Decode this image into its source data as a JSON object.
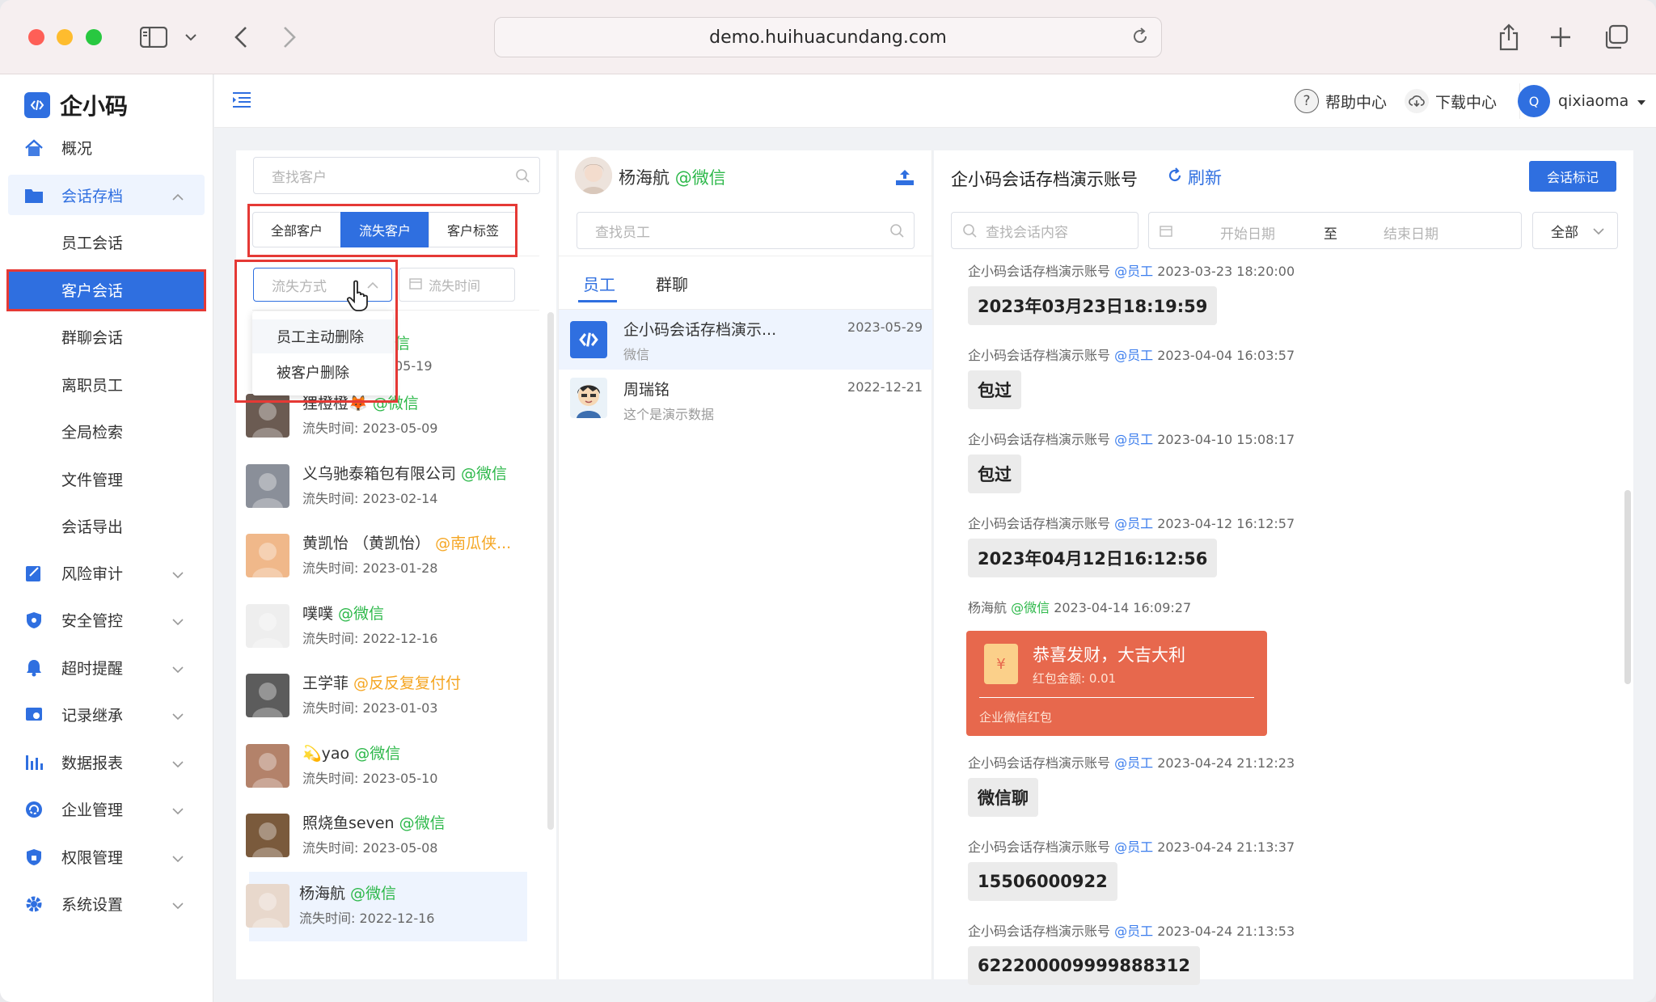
{
  "browser": {
    "url": "demo.huihuacundang.com"
  },
  "app": {
    "logo_text": "企小码"
  },
  "sidebar": {
    "items": [
      {
        "label": "概况",
        "icon": "home-icon"
      },
      {
        "label": "会话存档",
        "icon": "folder-icon"
      },
      {
        "label": "风险审计",
        "icon": "audit-icon"
      },
      {
        "label": "安全管控",
        "icon": "shield-icon"
      },
      {
        "label": "超时提醒",
        "icon": "bell-icon"
      },
      {
        "label": "记录继承",
        "icon": "inherit-icon"
      },
      {
        "label": "数据报表",
        "icon": "chart-icon"
      },
      {
        "label": "企业管理",
        "icon": "enterprise-icon"
      },
      {
        "label": "权限管理",
        "icon": "lock-shield-icon"
      },
      {
        "label": "系统设置",
        "icon": "gear-icon"
      }
    ],
    "sub_items": [
      {
        "label": "员工会话"
      },
      {
        "label": "客户会话"
      },
      {
        "label": "群聊会话"
      },
      {
        "label": "离职员工"
      },
      {
        "label": "全局检索"
      },
      {
        "label": "文件管理"
      },
      {
        "label": "会话导出"
      }
    ]
  },
  "header": {
    "help": "帮助中心",
    "download": "下载中心",
    "avatar_letter": "Q",
    "username": "qixiaoma"
  },
  "customers": {
    "search_placeholder": "查找客户",
    "tabs": [
      "全部客户",
      "流失客户",
      "客户标签"
    ],
    "filter_placeholder": "流失方式",
    "time_placeholder": "流失时间",
    "dropdown": [
      "员工主动删除",
      "被客户删除"
    ],
    "partial_item": {
      "tag_tail": "信",
      "time_tail": "05-19"
    },
    "list": [
      {
        "name": "狸橙橙🦊",
        "tag": "@微信",
        "tag_color": "green",
        "time": "流失时间: 2023-05-09"
      },
      {
        "name": "义乌驰泰箱包有限公司",
        "tag": "@微信",
        "tag_color": "green",
        "time": "流失时间: 2023-02-14"
      },
      {
        "name": "黄凯怡 （黄凯怡）",
        "tag": "@南瓜侠...",
        "tag_color": "orange",
        "time": "流失时间: 2023-01-28"
      },
      {
        "name": "噗噗",
        "tag": "@微信",
        "tag_color": "green",
        "time": "流失时间: 2022-12-16"
      },
      {
        "name": "王学菲",
        "tag": "@反反复复付付",
        "tag_color": "orange",
        "time": "流失时间: 2023-01-03"
      },
      {
        "name": "💫yao",
        "tag": "@微信",
        "tag_color": "green",
        "time": "流失时间: 2023-05-10"
      },
      {
        "name": "照烧鱼seven",
        "tag": "@微信",
        "tag_color": "green",
        "time": "流失时间: 2023-05-08"
      },
      {
        "name": "杨海航",
        "tag": "@微信",
        "tag_color": "green",
        "time": "流失时间: 2022-12-16"
      }
    ]
  },
  "employees": {
    "customer_name": "杨海航",
    "customer_tag": "@微信",
    "search_placeholder": "查找员工",
    "tabs": [
      "员工",
      "群聊"
    ],
    "list": [
      {
        "name": "企小码会话存档演示...",
        "sub": "微信",
        "date": "2023-05-29"
      },
      {
        "name": "周瑞铭",
        "sub": "这个是演示数据",
        "date": "2022-12-21"
      }
    ]
  },
  "chat": {
    "title": "企小码会话存档演示账号",
    "refresh": "刷新",
    "mark_button": "会话标记",
    "search_placeholder": "查找会话内容",
    "start_date": "开始日期",
    "to": "至",
    "end_date": "结束日期",
    "filter": "全部",
    "messages": [
      {
        "sender": "企小码会话存档演示账号",
        "tag": "@员工",
        "time": "2023-03-23 18:20:00",
        "text": "2023年03月23日18:19:59"
      },
      {
        "sender": "企小码会话存档演示账号",
        "tag": "@员工",
        "time": "2023-04-04 16:03:57",
        "text": "包过"
      },
      {
        "sender": "企小码会话存档演示账号",
        "tag": "@员工",
        "time": "2023-04-10 15:08:17",
        "text": "包过"
      },
      {
        "sender": "企小码会话存档演示账号",
        "tag": "@员工",
        "time": "2023-04-12 16:12:57",
        "text": "2023年04月12日16:12:56"
      },
      {
        "sender": "杨海航",
        "tag": "@微信",
        "time": "2023-04-14 16:09:27"
      },
      {
        "sender": "企小码会话存档演示账号",
        "tag": "@员工",
        "time": "2023-04-24 21:12:23",
        "text": "微信聊"
      },
      {
        "sender": "企小码会话存档演示账号",
        "tag": "@员工",
        "time": "2023-04-24 21:13:37",
        "text": "15506000922"
      },
      {
        "sender": "企小码会话存档演示账号",
        "tag": "@员工",
        "time": "2023-04-24 21:13:53",
        "text": "622200009999888312"
      }
    ],
    "red_packet": {
      "title": "恭喜发财，大吉大利",
      "amount": "红包金额: 0.01",
      "footer": "企业微信红包"
    }
  }
}
